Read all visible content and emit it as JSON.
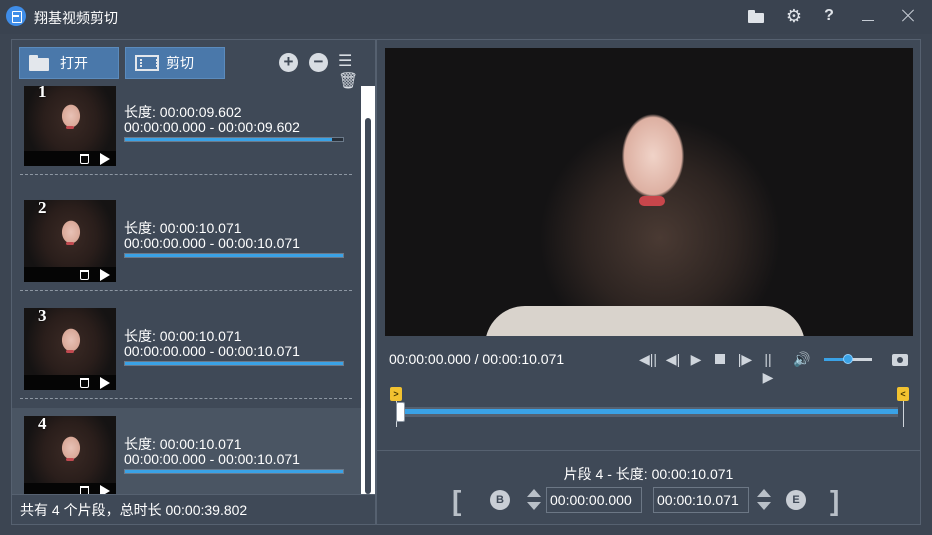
{
  "window": {
    "title": "翔基视频剪切",
    "icons": [
      "folder-icon",
      "gear-icon",
      "help-icon",
      "minimize-icon",
      "close-icon"
    ],
    "help_glyph": "?"
  },
  "toolbar": {
    "open_label": "打开",
    "cut_label": "剪切",
    "add_glyph": "+",
    "remove_glyph": "−",
    "clear_glyph": "☰"
  },
  "clips": [
    {
      "num": "1",
      "length": "长度: 00:00:09.602",
      "range": "00:00:00.000  -  00:00:09.602",
      "progress": 0.95
    },
    {
      "num": "2",
      "length": "长度: 00:00:10.071",
      "range": "00:00:00.000  -  00:00:10.071",
      "progress": 1.0
    },
    {
      "num": "3",
      "length": "长度: 00:00:10.071",
      "range": "00:00:00.000  -  00:00:10.071",
      "progress": 1.0
    },
    {
      "num": "4",
      "length": "长度: 00:00:10.071",
      "range": "00:00:00.000  -  00:00:10.071",
      "progress": 1.0
    }
  ],
  "selected_clip": 4,
  "status": "共有 4 个片段，总时长 00:00:39.802",
  "player": {
    "time": "00:00:00.000 / 00:00:10.071",
    "volume": 0.5,
    "controls": [
      "prev-keyframe-icon",
      "prev-frame-icon",
      "play-icon",
      "stop-icon",
      "next-frame-icon",
      "next-keyframe-icon",
      "volume-icon",
      "snapshot-icon"
    ]
  },
  "timeline": {
    "start_marker": ">",
    "end_marker": "<",
    "playhead": 0.0,
    "selection_start": 0.0,
    "selection_end": 1.0
  },
  "segment": {
    "info": "片段 4 - 长度: 00:00:10.071",
    "start": "00:00:00.000",
    "end": "00:00:10.071",
    "open_bracket": "[",
    "close_bracket": "]",
    "b_label": "B",
    "e_label": "E"
  },
  "colors": {
    "accent": "#3aa2e6",
    "button": "#4a78aa",
    "marker": "#f2c230"
  }
}
